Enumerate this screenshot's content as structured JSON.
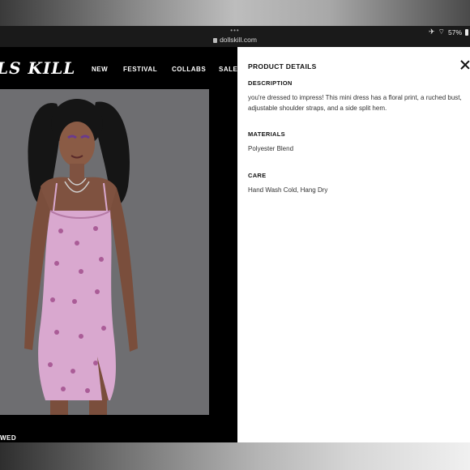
{
  "status": {
    "dots": "•••",
    "url": "dollskill.com",
    "battery": "57%"
  },
  "site": {
    "logo": "LS KILL",
    "nav": [
      "NEW",
      "FESTIVAL",
      "COLLABS",
      "SALE"
    ],
    "bottom_label": "WED"
  },
  "panel": {
    "title": "PRODUCT DETAILS",
    "sections": [
      {
        "heading": "DESCRIPTION",
        "text": "you're dressed to impress! This mini dress has a floral print, a ruched bust, adjustable shoulder straps, and a side split hem."
      },
      {
        "heading": "MATERIALS",
        "text": "Polyester Blend"
      },
      {
        "heading": "CARE",
        "text": "Hand Wash Cold, Hang Dry"
      }
    ]
  },
  "colors": {
    "site_bg": "#000000",
    "panel_bg": "#ffffff",
    "dress": "#d9a8cf"
  }
}
